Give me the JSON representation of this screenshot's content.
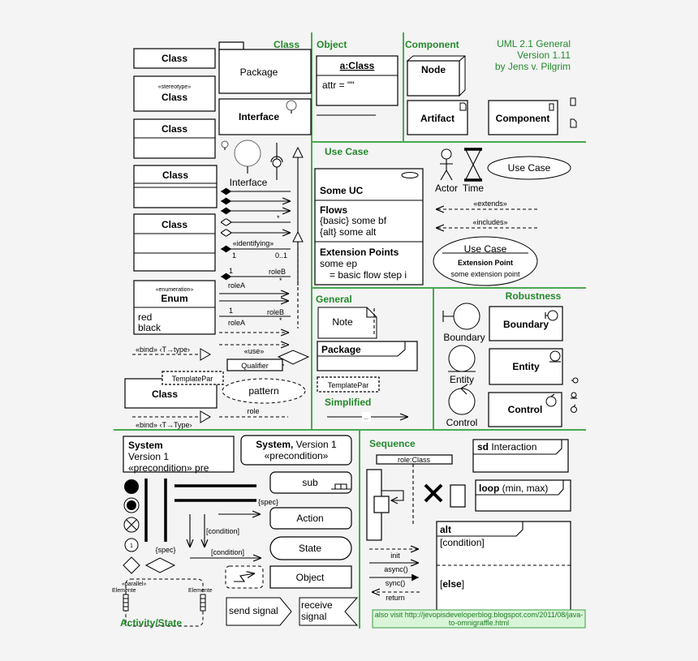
{
  "header": {
    "line1": "UML 2.1 General",
    "line2": "Version 1.11",
    "line3": "by Jens v. Pilgrim",
    "color": "#23892b"
  },
  "sections": {
    "class": "Class",
    "object": "Object",
    "component": "Component",
    "use_case": "Use Case",
    "general": "General",
    "simplified": "Simplified",
    "robustness": "Robustness",
    "activity": "Activity/State",
    "sequence": "Sequence"
  },
  "class_section": {
    "class1": "Class",
    "stereotype": "«stereotype»",
    "class2": "Class",
    "class3": "Class",
    "class4": "Class",
    "class5": "Class",
    "enum_stereotype": "«enumeration»",
    "enum_name": "Enum",
    "enum_values": [
      "red",
      "black"
    ],
    "package": "Package",
    "interface_box": "Interface",
    "interface_label": "Interface",
    "identifying": "«identifying»",
    "mult_1a": "1",
    "mult_01": "0..1",
    "assoc1": {
      "m1": "1",
      "roleB": "roleB",
      "star": "*",
      "roleA": "roleA"
    },
    "assoc2": {
      "m1": "1",
      "roleB": "roleB",
      "star": "*",
      "roleA": "roleA"
    },
    "star_small": "*",
    "bind1": "«bind» ‹T→type›",
    "use": "«use»",
    "qualifier": "Qualifier",
    "template_par": "TemplatePar",
    "template_class": "Class",
    "pattern": "pattern",
    "role": "role",
    "bind2": "«bind» ‹T→Type›"
  },
  "object_section": {
    "name": "a:Class",
    "attr": "attr = \"\""
  },
  "component_section": {
    "node": "Node",
    "artifact": "Artifact",
    "component": "Component"
  },
  "use_case_section": {
    "uc_title": "Some UC",
    "flows": "Flows",
    "flow1": "{basic} some bf",
    "flow2": "{alt} some alt",
    "ext_points": "Extension Points",
    "ep1": "some ep",
    "ep2": "= basic flow step i",
    "actor": "Actor",
    "time": "Time",
    "use_case": "Use Case",
    "extends": "«extends»",
    "includes": "«includes»",
    "uc2": "Use Case",
    "ext_point": "Extension Point",
    "ext_point_value": "some extension point"
  },
  "general_section": {
    "note": "Note",
    "package": "Package",
    "template_par": "TemplatePar",
    "ellipsis": "..."
  },
  "robustness_section": {
    "boundary": "Boundary",
    "entity": "Entity",
    "control": "Control",
    "boundary_box": "Boundary",
    "entity_box": "Entity",
    "control_box": "Control"
  },
  "activity_section": {
    "system1_title": "System",
    "system1_version": "Version 1",
    "system1_pre": "«precondition»  pre",
    "system2_title": "System,",
    "system2_version": " Version 1",
    "system2_pre": "«precondition»",
    "final_num": "1",
    "spec1": "{spec}",
    "spec2": "{spec}",
    "condition1": "[condition]",
    "condition2": "[condition]",
    "sub": "sub",
    "action": "Action",
    "state": "State",
    "object": "Object",
    "parallel": "«parallel»",
    "elemente1": "Elemente",
    "elemente2": "Elemente",
    "send_signal": "send signal",
    "receive_signal_1": "receive",
    "receive_signal_2": "signal"
  },
  "sequence_section": {
    "role": "role:Class",
    "sd": "sd",
    "sd_name": " Interaction",
    "loop": "loop",
    "loop_args": " (min, max)",
    "alt": "alt",
    "condition": "[condition]",
    "else": "else",
    "init": "init",
    "async": "async()",
    "sync": "sync()",
    "return": "return"
  },
  "footer_note": {
    "line1": "also visit http://jevopisdeveloperblog.blogspot.com/2011/08/java-",
    "line2": "to-omnigraffle.html",
    "bg": "#d8f5d8"
  }
}
